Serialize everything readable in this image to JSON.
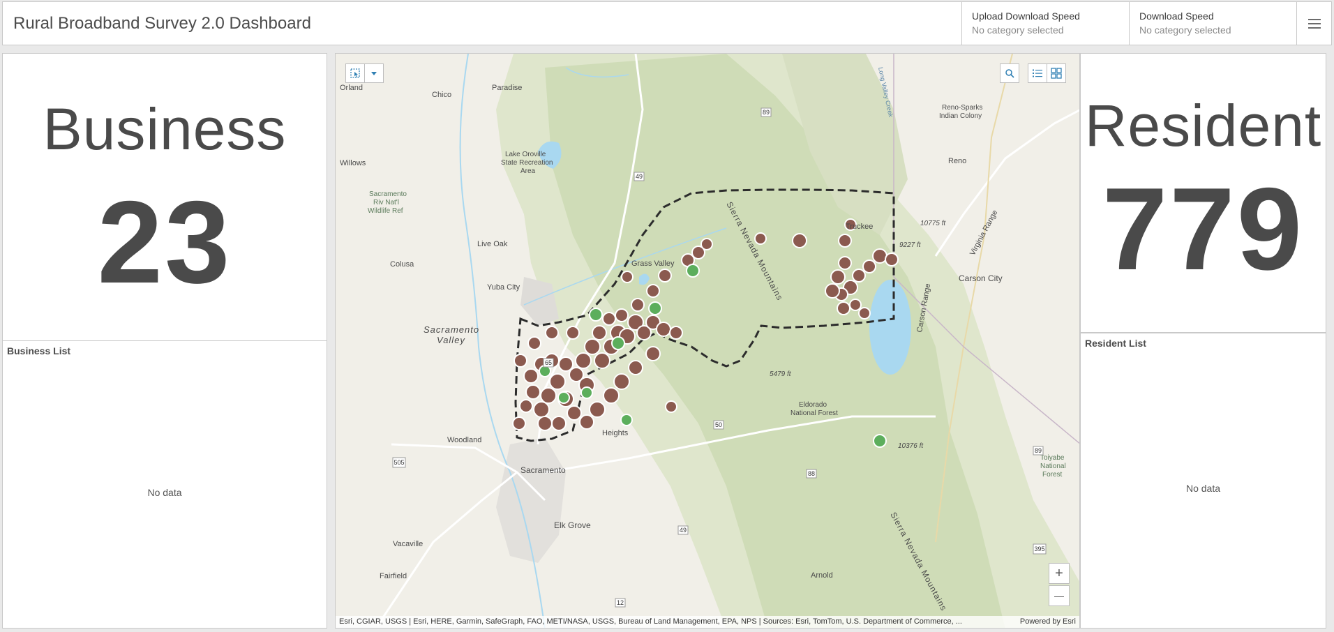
{
  "header": {
    "title": "Rural Broadband Survey 2.0 Dashboard",
    "selectors": [
      {
        "label": "Upload Download Speed",
        "value": "No category selected"
      },
      {
        "label": "Download Speed",
        "value": "No category selected"
      }
    ]
  },
  "business": {
    "label": "Business",
    "value": "23"
  },
  "resident": {
    "label": "Resident",
    "value": "779"
  },
  "business_list": {
    "title": "Business List",
    "empty": "No data"
  },
  "resident_list": {
    "title": "Resident List",
    "empty": "No data"
  },
  "map": {
    "labels": {
      "orland": "Orland",
      "chico": "Chico",
      "paradise": "Paradise",
      "willows": "Willows",
      "lake_oroville_1": "Lake Oroville",
      "lake_oroville_2": "State Recreation",
      "lake_oroville_3": "Area",
      "sac_refuge_1": "Sacramento",
      "sac_refuge_2": "Riv Nat'l",
      "sac_refuge_3": "Wildlife Ref",
      "colusa": "Colusa",
      "live_oak": "Live Oak",
      "yuba_city": "Yuba City",
      "grass_valley": "Grass Valley",
      "sac_valley_1": "Sacramento",
      "sac_valley_2": "Valley",
      "woodland": "Woodland",
      "sacramento": "Sacramento",
      "elk_grove": "Elk Grove",
      "vacaville": "Vacaville",
      "fairfield": "Fairfield",
      "arnold": "Arnold",
      "eldorado_1": "Eldorado",
      "eldorado_2": "National Forest",
      "truckee": "Truckee",
      "reno": "Reno",
      "reno_sparks_1": "Reno-Sparks",
      "reno_sparks_2": "Indian Colony",
      "carson_city": "Carson City",
      "toiyabe_1": "Toiyabe",
      "toiyabe_2": "National",
      "toiyabe_3": "Forest",
      "sierra_nevada_1": "Sierra Nevada Mountains",
      "sierra_nevada_2": "Sierra Nevada Mountains",
      "carson_range": "Carson Range",
      "virginia_range": "Virginia Range",
      "long_valley_creek": "Long Valley Creek",
      "elev_9227": "9227 ft",
      "elev_10775": "10775 ft",
      "elev_5479": "5479 ft",
      "elev_10376": "10376 ft",
      "heights": "Heights",
      "rt_89a": "89",
      "rt_89b": "89",
      "rt_49a": "49",
      "rt_49b": "49",
      "rt_65": "65",
      "rt_50": "50",
      "rt_88": "88",
      "rt_12": "12",
      "rt_505": "505",
      "rt_395": "395"
    },
    "attribution": "Esri, CGIAR, USGS | Esri, HERE, Garmin, SafeGraph, FAO, METI/NASA, USGS, Bureau of Land Management, EPA, NPS | Sources: Esri, TomTom, U.S. Department of Commerce, ...",
    "powered_by": "Powered by Esri",
    "zoom_in": "+",
    "zoom_out": "—",
    "colors": {
      "resident_marker": "#8b5a4f",
      "business_marker": "#5cae5c",
      "water": "#a9d8f0",
      "land": "#f1efe8",
      "forest": "#cfdcb7"
    }
  }
}
